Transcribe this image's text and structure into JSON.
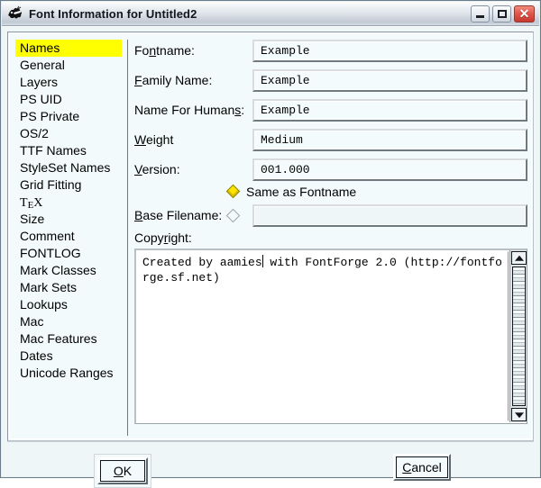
{
  "window": {
    "title": "Font Information for Untitled2",
    "icon": "fontforge-moth-icon",
    "buttons": {
      "minimize": "Minimize",
      "maximize": "Maximize",
      "close": "Close"
    }
  },
  "sidebar": {
    "selected": "Names",
    "items": [
      {
        "label": "Names",
        "selected": true
      },
      {
        "label": "General",
        "selected": false
      },
      {
        "label": "Layers",
        "selected": false
      },
      {
        "label": "PS UID",
        "selected": false
      },
      {
        "label": "PS Private",
        "selected": false
      },
      {
        "label": "OS/2",
        "selected": false
      },
      {
        "label": "TTF Names",
        "selected": false
      },
      {
        "label": "StyleSet Names",
        "selected": false
      },
      {
        "label": "Grid Fitting",
        "selected": false
      },
      {
        "label": "TeX",
        "selected": false
      },
      {
        "label": "Size",
        "selected": false
      },
      {
        "label": "Comment",
        "selected": false
      },
      {
        "label": "FONTLOG",
        "selected": false
      },
      {
        "label": "Mark Classes",
        "selected": false
      },
      {
        "label": "Mark Sets",
        "selected": false
      },
      {
        "label": "Lookups",
        "selected": false
      },
      {
        "label": "Mac",
        "selected": false
      },
      {
        "label": "Mac Features",
        "selected": false
      },
      {
        "label": "Dates",
        "selected": false
      },
      {
        "label": "Unicode Ranges",
        "selected": false
      }
    ]
  },
  "form": {
    "fontname": {
      "label": "Fontname:",
      "value": "Example"
    },
    "family_name": {
      "label": "Family Name:",
      "value": "Example"
    },
    "name_for_humans": {
      "label": "Name For Humans:",
      "value": "Example"
    },
    "weight": {
      "label": "Weight",
      "value": "Medium"
    },
    "version": {
      "label": "Version:",
      "value": "001.000"
    },
    "same_as_fontname": {
      "label": "Same as Fontname",
      "selected": true
    },
    "base_filename": {
      "label": "Base Filename:",
      "value": "",
      "selected": false
    },
    "copyright": {
      "label": "Copyright:",
      "value": "Created by aamies with FontForge 2.0 (http://fontforge.sf.net)",
      "text_before_caret": "Created by aamies",
      "text_after_caret": " with FontForge 2.0 (http://fontforge.sf.net)"
    }
  },
  "footer": {
    "ok": {
      "label": "OK",
      "default": true
    },
    "cancel": {
      "label": "Cancel",
      "default": false
    }
  },
  "colors": {
    "selection_highlight": "#ffff00",
    "window_background": "#eef6f7",
    "panel_background": "#f2fafb",
    "close_button": "#c9372c",
    "radio_selected": "#ffe400"
  }
}
